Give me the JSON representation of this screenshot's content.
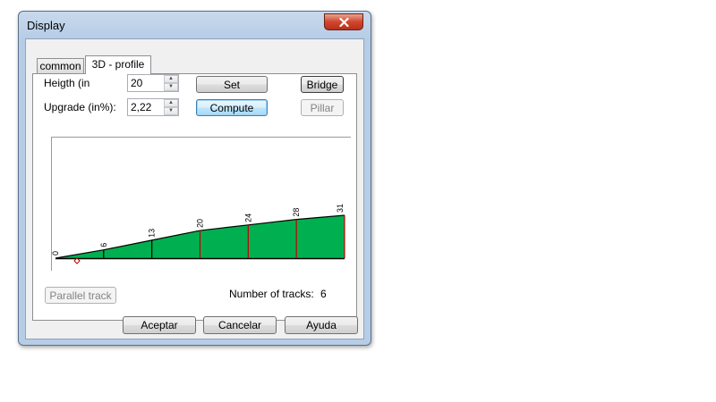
{
  "window": {
    "title": "Display",
    "close_icon": "close-icon"
  },
  "tabs": [
    {
      "label": "common",
      "active": false
    },
    {
      "label": "3D - profile",
      "active": true
    }
  ],
  "form": {
    "height_label": "Heigth (in",
    "height_value": "20",
    "upgrade_label": "Upgrade (in%):",
    "upgrade_value": "2,22"
  },
  "buttons": {
    "set": "Set",
    "compute": "Compute",
    "bridge": "Bridge",
    "pillar": "Pillar",
    "parallel_track": "Parallel track"
  },
  "tracks": {
    "label": "Number of tracks:",
    "value": "6"
  },
  "footer": {
    "accept": "Aceptar",
    "cancel": "Cancelar",
    "help": "Ayuda"
  },
  "colors": {
    "fill": "#00b050",
    "pillar": "#c00000",
    "outline": "#000000"
  },
  "chart_data": {
    "type": "area",
    "x": [
      0,
      1,
      2,
      3,
      4,
      5,
      6
    ],
    "values": [
      0,
      6,
      13,
      20,
      24,
      28,
      31
    ],
    "point_labels": [
      "0",
      "6",
      "13",
      "20",
      "24",
      "28",
      "31"
    ],
    "ylim": [
      0,
      31
    ]
  }
}
